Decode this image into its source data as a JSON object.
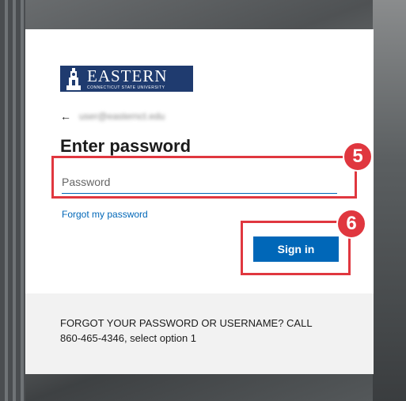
{
  "logo": {
    "title": "EASTERN",
    "subtitle": "CONNECTICUT STATE UNIVERSITY"
  },
  "back": {
    "icon": "←",
    "email": "user@easternct.edu"
  },
  "title": "Enter password",
  "password": {
    "placeholder": "Password",
    "value": ""
  },
  "forgot_link": "Forgot my password",
  "sign_in_label": "Sign in",
  "footer_text": "FORGOT YOUR PASSWORD OR USERNAME? CALL 860-465-4346, select option 1",
  "annotations": {
    "step_password": "5",
    "step_signin": "6"
  },
  "colors": {
    "accent": "#0067b8",
    "brand": "#1f3b6f",
    "highlight": "#e0373f"
  }
}
